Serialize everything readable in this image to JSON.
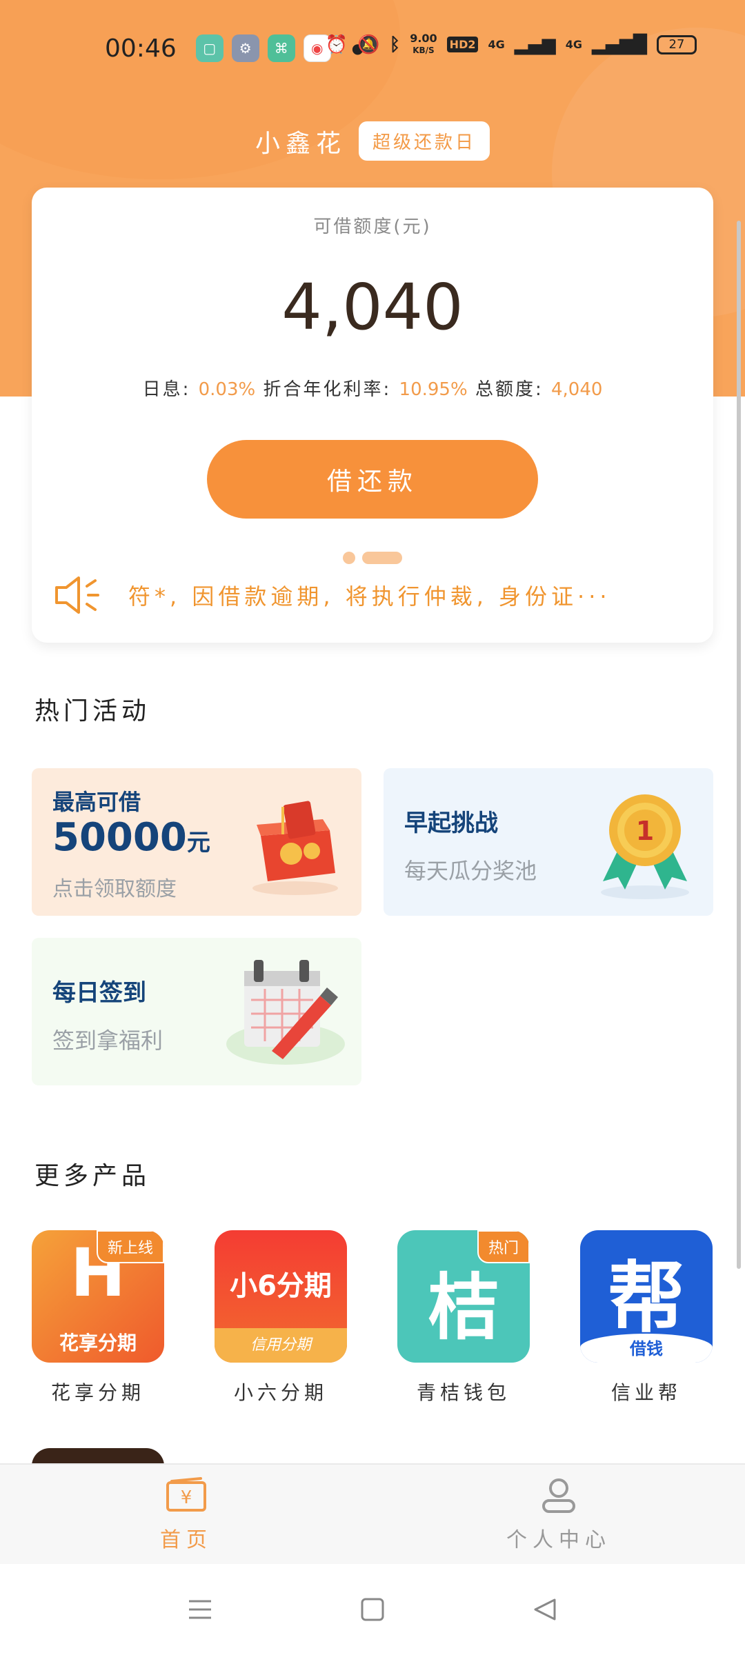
{
  "status_bar": {
    "time": "00:46",
    "network_speed_value": "9.00",
    "network_speed_unit": "KB/S",
    "hd": "HD2",
    "signal1": "4G",
    "signal2": "4G",
    "battery": "27"
  },
  "header": {
    "title": "小鑫花",
    "badge": "超级还款日"
  },
  "card": {
    "limit_label": "可借额度(元)",
    "limit_value": "4,040",
    "daily_label": "日息:",
    "daily_value": "0.03%",
    "annual_label": "折合年化利率:",
    "annual_value": "10.95%",
    "total_label": "总额度:",
    "total_value": "4,040",
    "button_label": "借还款",
    "notice": "符*, 因借款逾期, 将执行仲裁, 身份证···"
  },
  "hot": {
    "title": "热门活动",
    "promo1": {
      "line1": "最高可借",
      "amount": "50000",
      "unit": "元",
      "sub": "点击领取额度"
    },
    "promo2": {
      "title": "早起挑战",
      "sub": "每天瓜分奖池"
    },
    "promo3": {
      "title": "每日签到",
      "sub": "签到拿福利"
    }
  },
  "more": {
    "title": "更多产品",
    "products": [
      {
        "name": "花享分期",
        "tag": "新上线",
        "icon_text": "花享分期"
      },
      {
        "name": "小六分期",
        "tag": "",
        "icon_text": "小6分期",
        "icon_sub": "信用分期"
      },
      {
        "name": "青桔钱包",
        "tag": "热门",
        "icon_text": "桔"
      },
      {
        "name": "信业帮",
        "tag": "",
        "icon_text": "帮",
        "icon_sub": "借钱"
      }
    ]
  },
  "tabs": [
    {
      "label": "首页",
      "icon": "home-wallet-icon",
      "active": true
    },
    {
      "label": "个人中心",
      "icon": "person-icon",
      "active": false
    }
  ],
  "colors": {
    "brand_orange": "#f7913b",
    "hero_bg": "#f8a45a",
    "title_blue": "#15447a"
  }
}
